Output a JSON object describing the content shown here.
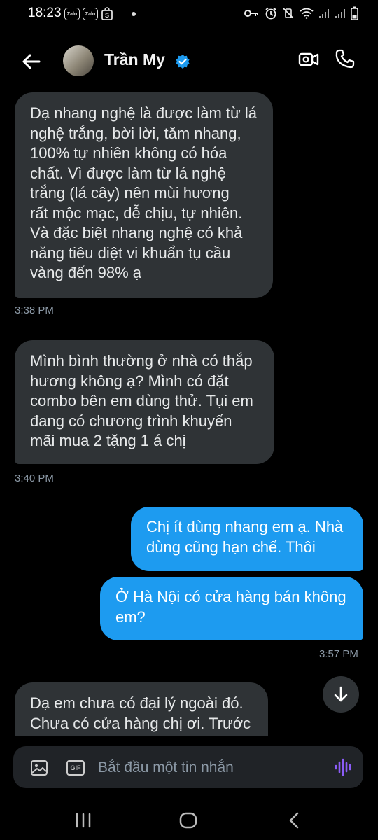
{
  "status_bar": {
    "time": "18:23",
    "apps": [
      "Zalo",
      "Zalo"
    ]
  },
  "header": {
    "contact_name": "Trần My",
    "back_icon": "arrow-left-icon",
    "video_icon": "video-call-icon",
    "call_icon": "phone-icon",
    "verified_color": "#1d9bf0"
  },
  "messages": [
    {
      "direction": "incoming",
      "lines": [
        "Dạ nhang nghệ là được làm từ lá",
        "nghệ trắng, bời lời, tăm nhang,",
        "100% tự nhiên không có hóa",
        "chất. Vì được làm từ lá nghệ",
        "trắng (lá cây) nên mùi hương",
        "rất mộc mạc, dễ chịu, tự nhiên.",
        "Và đặc biệt nhang nghệ có khả",
        "năng tiêu diệt vi khuẩn tụ cầu",
        "vàng đến 98% ạ"
      ]
    },
    {
      "direction": "incoming",
      "lines": [
        "Mình bình thường ở nhà có thắp",
        "hương không ạ? Mình có đặt",
        "combo bên em dùng thử. Tụi em",
        "đang có chương trình khuyến",
        "mãi mua 2 tặng 1  á chị"
      ]
    },
    {
      "direction": "outgoing",
      "lines": [
        "Chị ít dùng nhang em ạ. Nhà",
        "dùng cũng hạn chế. Thôi"
      ]
    },
    {
      "direction": "outgoing",
      "lines": [
        "Ở Hà Nội có cửa hàng bán không",
        "em?"
      ]
    },
    {
      "direction": "incoming",
      "lines": [
        "Dạ em chưa có đại lý ngoài đó.",
        "Chưa có cửa hàng chị ơi. Trước"
      ]
    }
  ],
  "timestamps": [
    "3:38 PM",
    "3:40 PM",
    "3:57 PM"
  ],
  "composer": {
    "placeholder": "Bắt đầu một tin nhắn",
    "gif_label": "GIF",
    "media_icon": "image-icon",
    "voice_icon": "voice-message-icon",
    "voice_color": "#8b5cf6"
  },
  "scroll_icon": "arrow-down-icon",
  "colors": {
    "background": "#000000",
    "incoming_bubble": "#2f3336",
    "outgoing_bubble": "#1d9bf0",
    "timestamp": "#8b98a5"
  },
  "system_nav": [
    "recent-apps-icon",
    "home-icon",
    "back-icon"
  ]
}
